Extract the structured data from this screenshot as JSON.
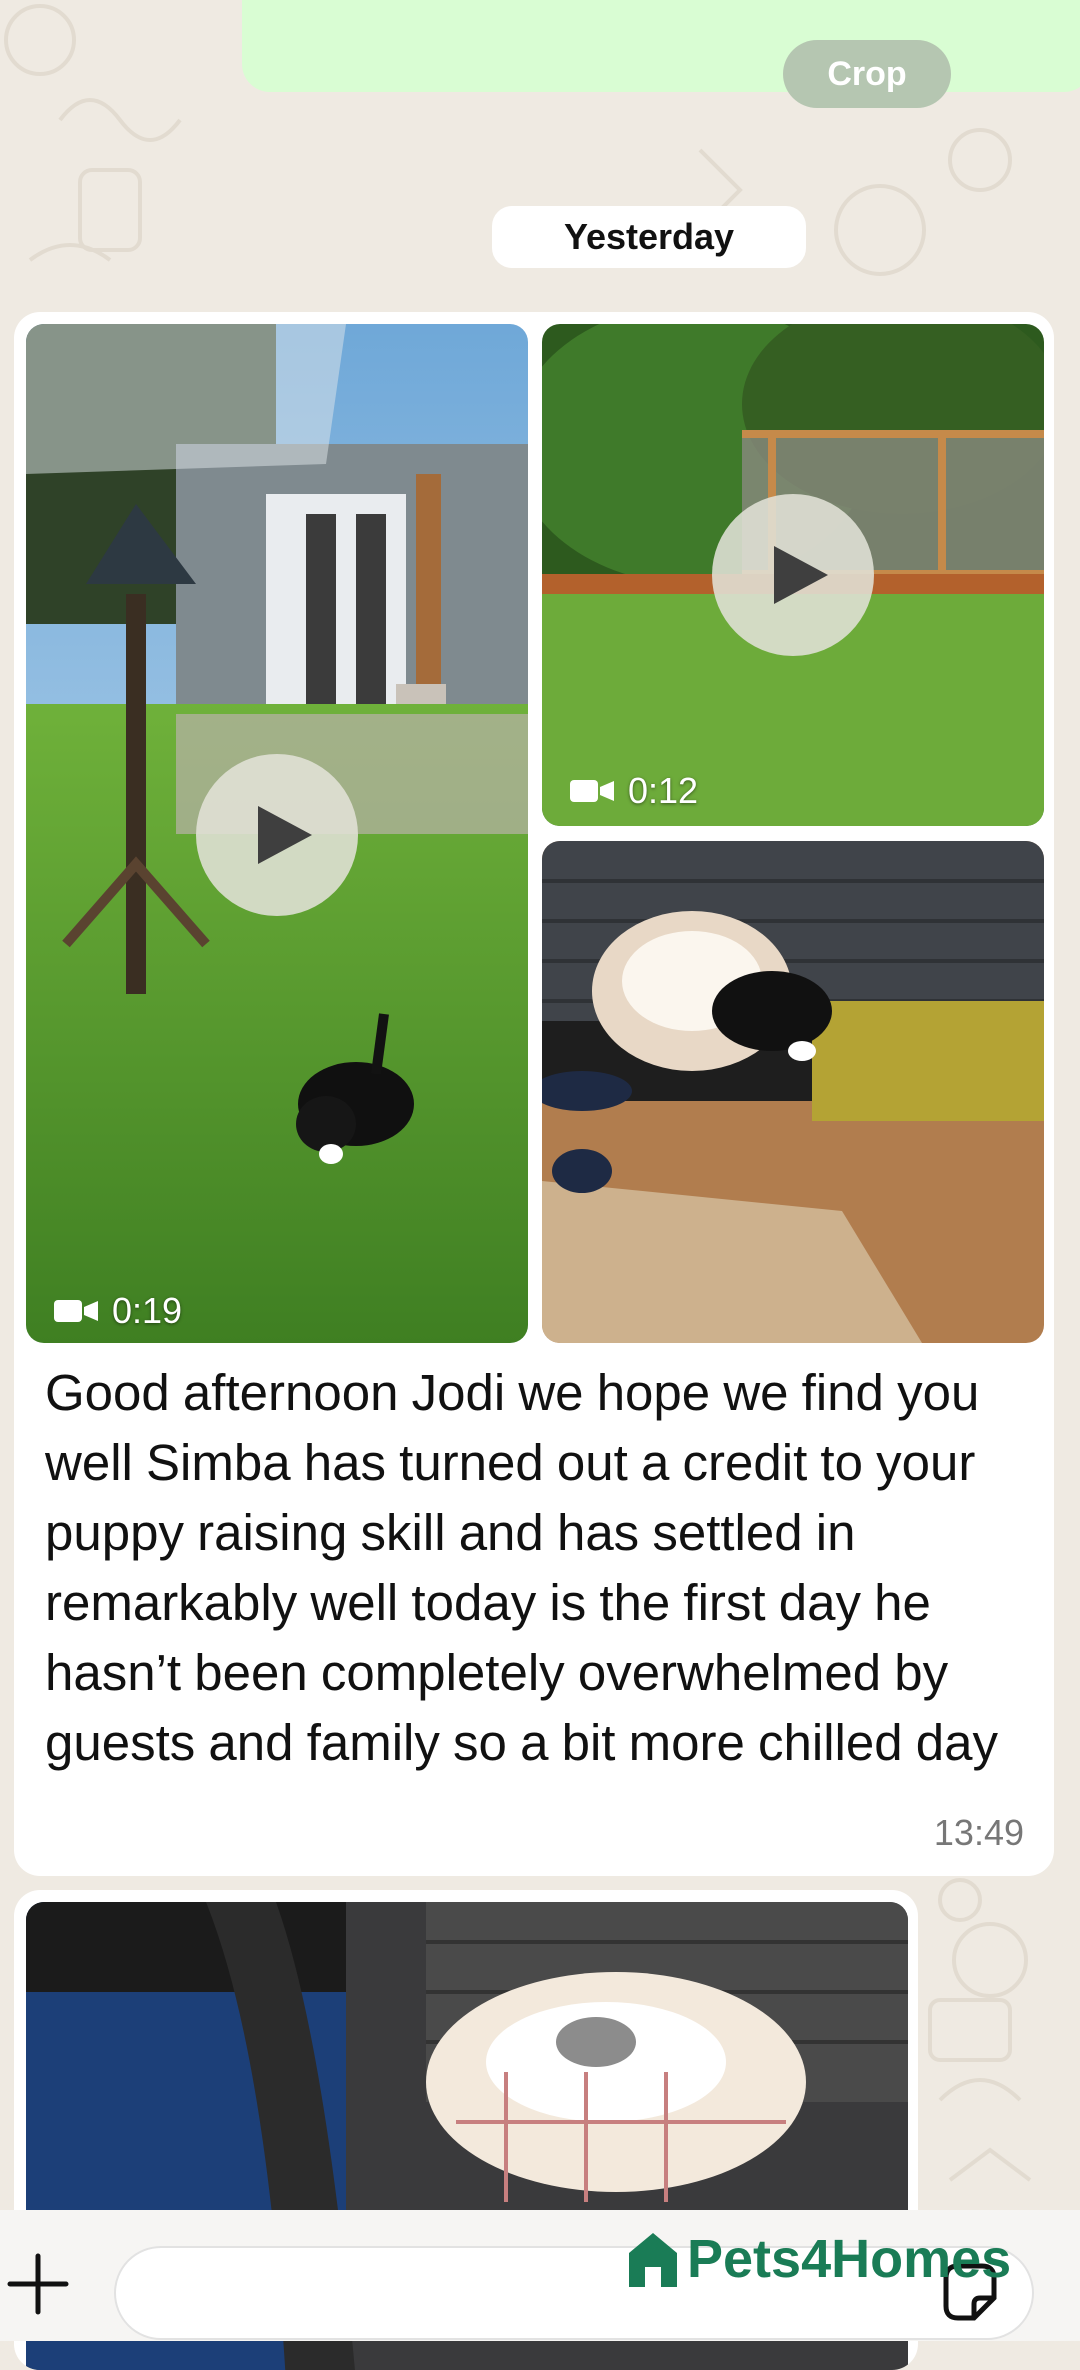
{
  "outgoing": {
    "crop_label": "Crop"
  },
  "date_divider": "Yesterday",
  "message": {
    "videos": [
      {
        "duration": "0:19",
        "desc": "puppy-in-garden-video"
      },
      {
        "duration": "0:12",
        "desc": "lawn-video"
      }
    ],
    "photo": "puppy-on-bed-photo",
    "text": "Good afternoon Jodi we hope we find you well Simba has turned out a credit to your puppy raising skill and has settled in remarkably well today is the first day he hasn’t been completely overwhelmed by guests and family so a bit more chilled day",
    "time": "13:49"
  },
  "next_message": {
    "photo": "puppy-bed-living-room-photo"
  },
  "input_bar": {
    "placeholder": ""
  },
  "watermark": "Pets4Homes",
  "colors": {
    "wallpaper": "#efeae2",
    "outgoing_bubble": "#d9fdd3",
    "brand": "#1a7c56"
  }
}
